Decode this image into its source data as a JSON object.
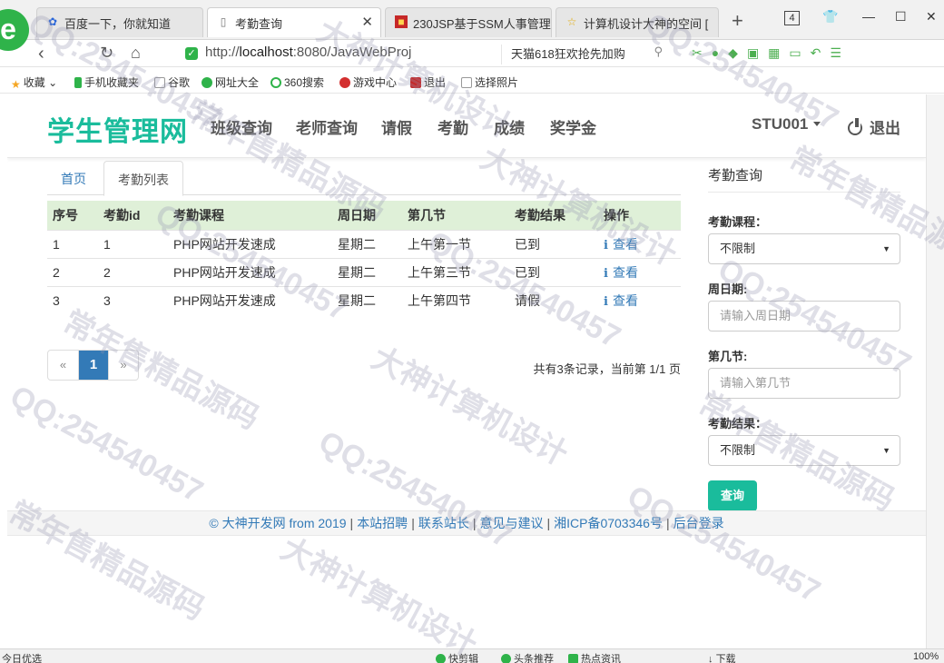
{
  "browser": {
    "tabs": [
      {
        "title": "百度一下，你就知道",
        "icon": "baidu-paw-icon"
      },
      {
        "title": "考勤查询",
        "icon": "page-icon"
      },
      {
        "title": "230JSP基于SSM人事管理",
        "icon": "red-square-icon"
      },
      {
        "title": "计算机设计大神的空间 [",
        "icon": "star-icon"
      }
    ],
    "tab_count": "4",
    "url_prefix": "http://",
    "url_host": "localhost",
    "url_rest": ":8080/JavaWebProj",
    "promo_text": "天猫618狂欢抢先加购",
    "bookmarks": [
      "收藏",
      "手机收藏夹",
      "谷歌",
      "网址大全",
      "360搜索",
      "游戏中心",
      "退出",
      "选择照片"
    ],
    "status": {
      "left": "今日优选",
      "items": [
        "快剪辑",
        "头条推荐",
        "热点资讯",
        "下载"
      ],
      "zoom": "100%"
    }
  },
  "site": {
    "brand": "学生管理网",
    "menu": [
      "班级查询",
      "老师查询",
      "请假",
      "考勤",
      "成绩",
      "奖学金"
    ],
    "user": "STU001",
    "logout": "退出"
  },
  "breadcrumb_tabs": {
    "home": "首页",
    "current": "考勤列表"
  },
  "table": {
    "headers": [
      "序号",
      "考勤id",
      "考勤课程",
      "周日期",
      "第几节",
      "考勤结果",
      "操作"
    ],
    "rows": [
      {
        "no": "1",
        "id": "1",
        "course": "PHP网站开发速成",
        "weekday": "星期二",
        "section": "上午第一节",
        "result": "已到",
        "action": "查看"
      },
      {
        "no": "2",
        "id": "2",
        "course": "PHP网站开发速成",
        "weekday": "星期二",
        "section": "上午第三节",
        "result": "已到",
        "action": "查看"
      },
      {
        "no": "3",
        "id": "3",
        "course": "PHP网站开发速成",
        "weekday": "星期二",
        "section": "上午第四节",
        "result": "请假",
        "action": "查看"
      }
    ]
  },
  "pagination": {
    "prev": "«",
    "current": "1",
    "next": "»",
    "summary": "共有3条记录，当前第 1/1 页"
  },
  "search": {
    "title": "考勤查询",
    "course_label": "考勤课程：",
    "course_value": "不限制",
    "weekday_label": "周日期:",
    "weekday_placeholder": "请输入周日期",
    "section_label": "第几节:",
    "section_placeholder": "请输入第几节",
    "result_label": "考勤结果：",
    "result_value": "不限制",
    "submit": "查询"
  },
  "footer": {
    "links": [
      "© 大神开发网 from 2019",
      "本站招聘",
      "联系站长",
      "意见与建议",
      "湘ICP备0703346号",
      "后台登录"
    ]
  },
  "watermarks": [
    "QQ:254540457",
    "常年售精品源码",
    "大神计算机设计"
  ],
  "colors": {
    "brand": "#1abc9c",
    "link": "#337ab7",
    "table_header": "#dff0d8"
  }
}
